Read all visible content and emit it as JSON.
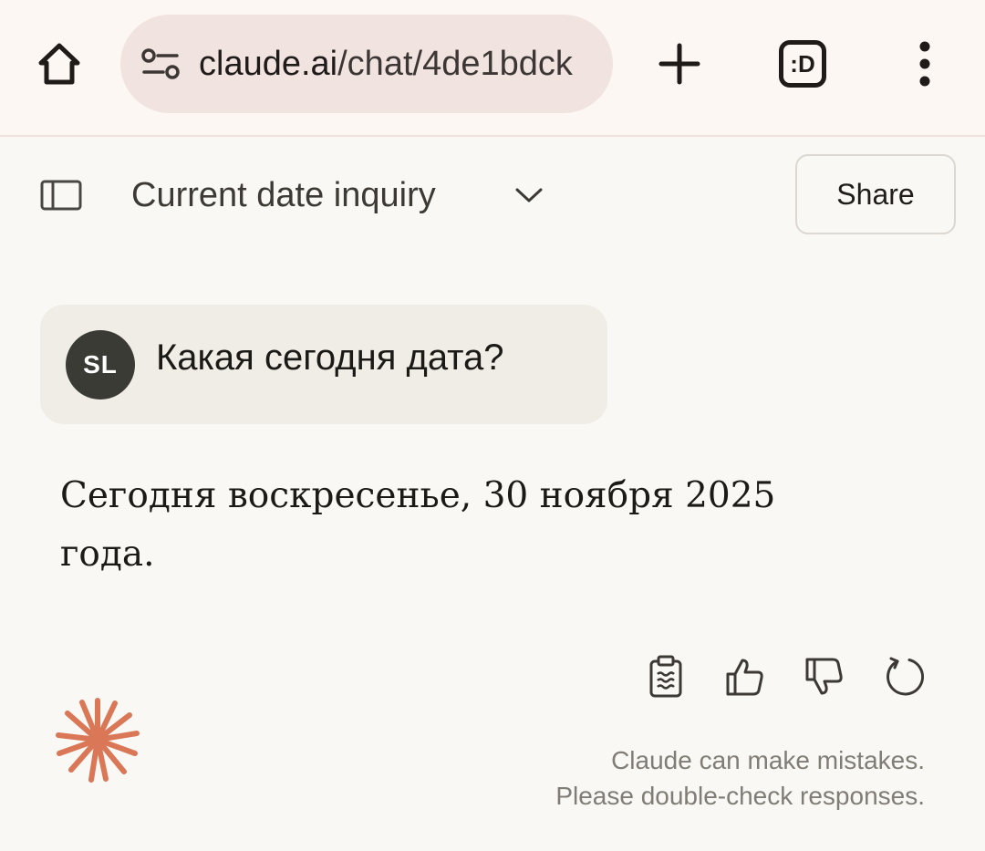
{
  "browser": {
    "url_host": "claude.ai",
    "url_path": "/chat/4de1bdck",
    "tab_count_label": ":D",
    "colors": {
      "toolbar_bg": "#fdf7f3",
      "url_pill_bg": "#f1e3df"
    }
  },
  "header": {
    "title": "Current date inquiry",
    "share_label": "Share"
  },
  "messages": {
    "user": {
      "initials": "SL",
      "text": "Какая сегодня дата?"
    },
    "assistant": {
      "text": "Сегодня воскресенье, 30 ноября 2025 года."
    }
  },
  "actions": {
    "icons": [
      "copy-icon",
      "thumbs-up-icon",
      "thumbs-down-icon",
      "retry-icon"
    ]
  },
  "footer": {
    "disclaimer_line1": "Claude can make mistakes.",
    "disclaimer_line2": "Please double-check responses.",
    "brand_color": "#d97757"
  }
}
